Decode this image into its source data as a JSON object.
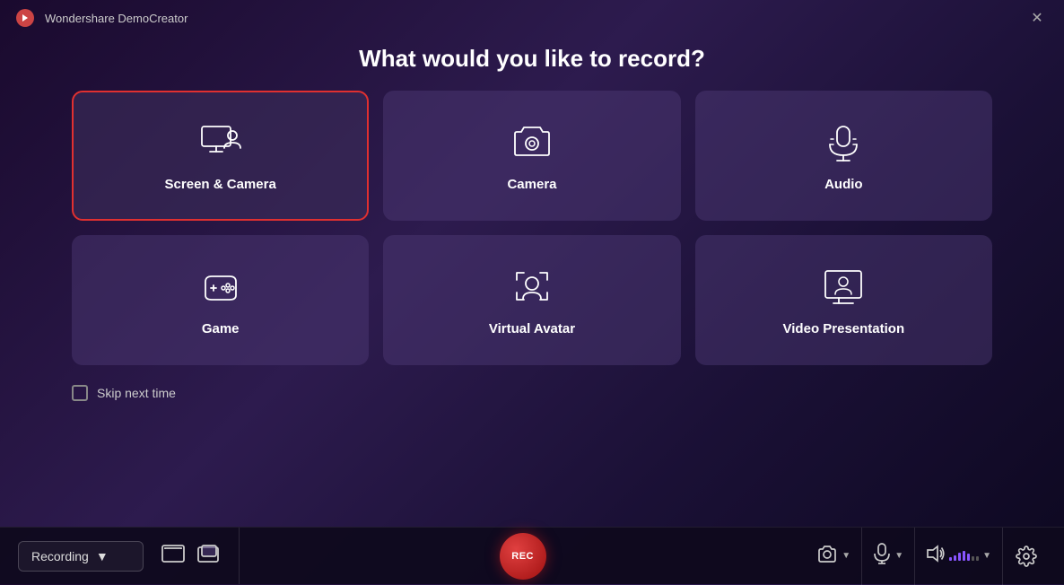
{
  "app": {
    "title": "Wondershare DemoCreator"
  },
  "header": {
    "question": "What would you like to record?"
  },
  "cards": [
    {
      "id": "screen-camera",
      "label": "Screen & Camera",
      "icon": "screen-camera",
      "selected": true
    },
    {
      "id": "camera",
      "label": "Camera",
      "icon": "camera",
      "selected": false
    },
    {
      "id": "audio",
      "label": "Audio",
      "icon": "audio",
      "selected": false
    },
    {
      "id": "game",
      "label": "Game",
      "icon": "game",
      "selected": false
    },
    {
      "id": "virtual-avatar",
      "label": "Virtual Avatar",
      "icon": "virtual-avatar",
      "selected": false
    },
    {
      "id": "video-presentation",
      "label": "Video Presentation",
      "icon": "video-presentation",
      "selected": false
    }
  ],
  "skip": {
    "label": "Skip next time"
  },
  "bottom": {
    "recording_label": "Recording",
    "rec_label": "REC"
  }
}
